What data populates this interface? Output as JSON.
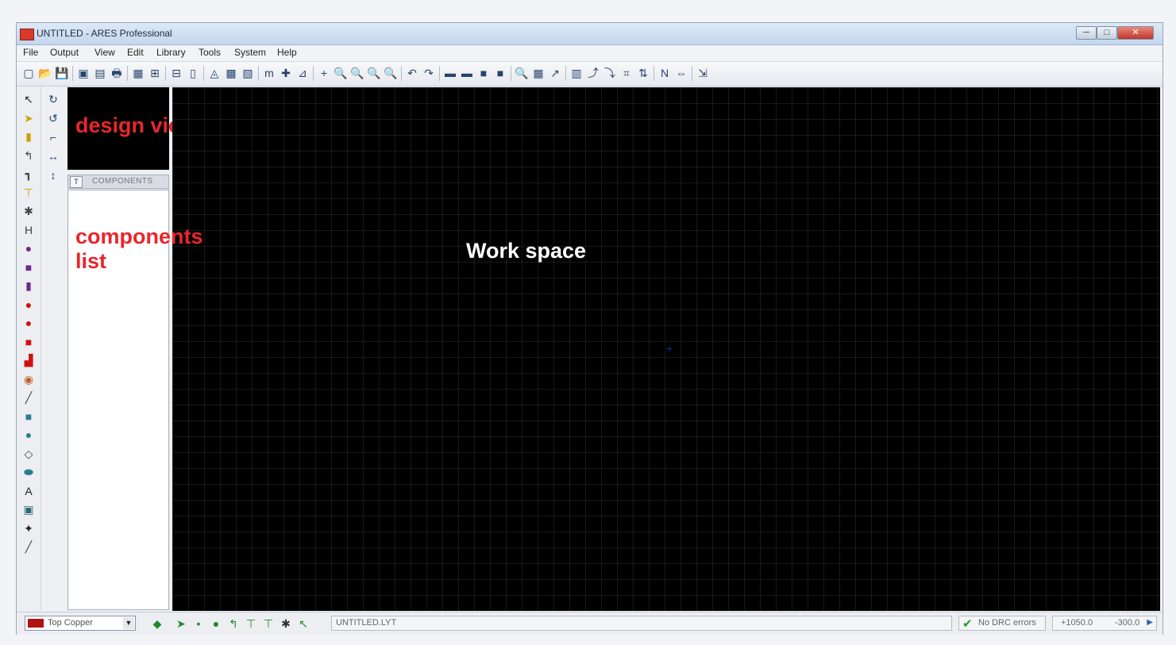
{
  "window": {
    "title": "UNTITLED - ARES Professional",
    "min_glyph": "─",
    "max_glyph": "□",
    "close_glyph": "✕"
  },
  "menu": [
    "File",
    "Output",
    "View",
    "Edit",
    "Library",
    "Tools",
    "System",
    "Help"
  ],
  "toolbar_icons": [
    "▢",
    "📂",
    "💾",
    "▣",
    "▤",
    "🖶",
    "▦",
    "⊞",
    "⊟",
    "▯",
    "◬",
    "▩",
    "▧",
    "m",
    "✚",
    "⊿",
    "+",
    "🔍",
    "🔍",
    "🔍",
    "🔍",
    "↶",
    "↷",
    "▬",
    "▬",
    "■",
    "■",
    "🔍",
    "▦",
    "↗",
    "▥",
    "⤴",
    "⤵",
    "⌗",
    "⇅",
    "N",
    "⇔",
    "⇲"
  ],
  "left_tools": [
    "↖",
    "➤",
    "▮",
    "↰",
    "┓",
    "⊤",
    "✱",
    "H",
    "●",
    "■",
    "▮",
    "●",
    "●",
    "■",
    "▟",
    "◉",
    "╱",
    "■",
    "●",
    "◇",
    "⬬",
    "A",
    "▣",
    "✦",
    "╱"
  ],
  "left_tools2": [
    "↻",
    "↺",
    "⌐",
    "↔",
    "↕"
  ],
  "side_panel": {
    "toggle": "T",
    "components_header": "COMPONENTS"
  },
  "annotations": {
    "design_view": "design view",
    "components_list_line1": "components",
    "components_list_line2": "list",
    "workspace": "Work space"
  },
  "workspace": {
    "origin_glyph": "+"
  },
  "status": {
    "layer": "Top Copper",
    "layer_arrow": "▼",
    "filename": "UNTITLED.LYT",
    "drc_check": "✔",
    "drc": "No DRC errors",
    "coord_x": "+1050.0",
    "coord_y": "-300.0",
    "coord_arrow": "▶",
    "icons": [
      "◆",
      "➤",
      "•",
      "●",
      "↰",
      "⊤",
      "⊤",
      "✱",
      "↖"
    ]
  },
  "colors": {
    "layer_swatch": "#b01212",
    "annotation_red": "#e8262b",
    "workspace_bg": "#000000"
  }
}
